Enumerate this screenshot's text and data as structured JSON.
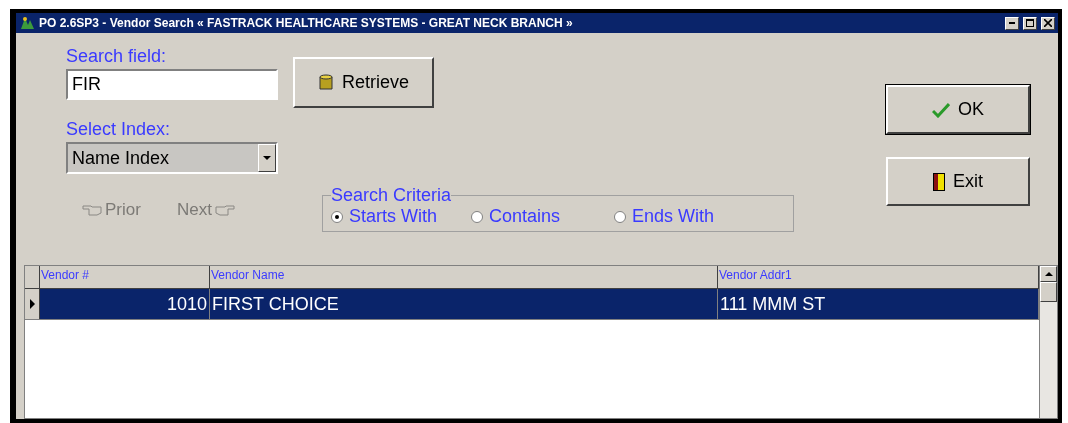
{
  "window": {
    "title": "PO 2.6SP3 - Vendor Search « FASTRACK HEALTHCARE SYSTEMS - GREAT NECK BRANCH »"
  },
  "search_field": {
    "label": "Search field:",
    "value": "FIR"
  },
  "retrieve_button": {
    "label": "Retrieve"
  },
  "select_index": {
    "label": "Select Index:",
    "value": "Name Index"
  },
  "nav_buttons": [
    {
      "kind": "prior",
      "label": "Prior",
      "disabled": true
    },
    {
      "kind": "next",
      "label": "Next",
      "disabled": true
    }
  ],
  "search_criteria": {
    "title": "Search Criteria",
    "options": [
      {
        "label": "Starts With",
        "selected": true
      },
      {
        "label": "Contains",
        "selected": false
      },
      {
        "label": "Ends With",
        "selected": false
      }
    ]
  },
  "buttons": [
    {
      "kind": "ok",
      "label": "OK"
    },
    {
      "kind": "exit",
      "label": "Exit"
    }
  ],
  "table": {
    "columns": [
      "Vendor #",
      "Vendor Name",
      "Vendor Addr1"
    ],
    "rows": [
      {
        "cells": [
          "1010",
          "FIRST CHOICE",
          "111 MMM ST"
        ],
        "selected": true
      }
    ]
  }
}
